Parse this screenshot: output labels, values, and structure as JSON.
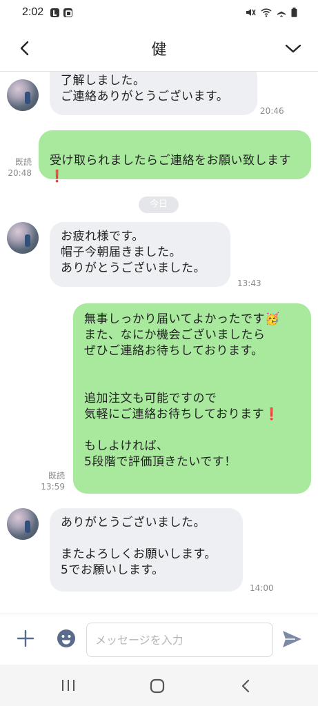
{
  "status_bar": {
    "time": "2:02",
    "icons": [
      "line-notification-icon",
      "notification-icon",
      "mute-icon",
      "wifi-icon",
      "airplane-icon",
      "battery-icon"
    ]
  },
  "header": {
    "title": "健",
    "back_icon": "chevron-left-icon",
    "menu_icon": "chevron-down-icon"
  },
  "chat": {
    "messages": [
      {
        "side": "in",
        "text": "了解しました。\nご連絡ありがとうございます。",
        "time": "20:46"
      },
      {
        "side": "out",
        "text": "受け取られましたらご連絡をお願い致します",
        "emoji": "❗",
        "read": "既読",
        "time": "20:48"
      },
      {
        "side": "date",
        "text": "今日"
      },
      {
        "side": "in",
        "text": "お疲れ様です。\n帽子今朝届きました。\nありがとうございました。",
        "time": "13:43"
      },
      {
        "side": "out",
        "line1": "無事しっかり届いてよかったです",
        "line1_emoji": "🥳",
        "text2": "また、なにか機会ございましたら\nぜひご連絡お待ちしております。",
        "text3": "追加注文も可能ですので\n気軽にご連絡お待ちしております",
        "line3_emoji": "❗",
        "text4": "もしよければ、\n5段階で評価頂きたいです！",
        "read": "既読",
        "time": "13:59"
      },
      {
        "side": "in",
        "text": "ありがとうございました。\n\nまたよろしくお願いします。\n5でお願いします。",
        "time": "14:00"
      }
    ]
  },
  "input_bar": {
    "placeholder": "メッセージを入力",
    "value": "",
    "icons": [
      "plus-icon",
      "emoji-icon",
      "send-icon"
    ]
  },
  "nav_bar": {
    "icons": [
      "recent-apps-icon",
      "home-icon",
      "back-icon"
    ]
  },
  "colors": {
    "outgoing_bubble": "#a8e99e",
    "incoming_bubble": "#eeeff2",
    "accent": "#5b6b8c"
  }
}
